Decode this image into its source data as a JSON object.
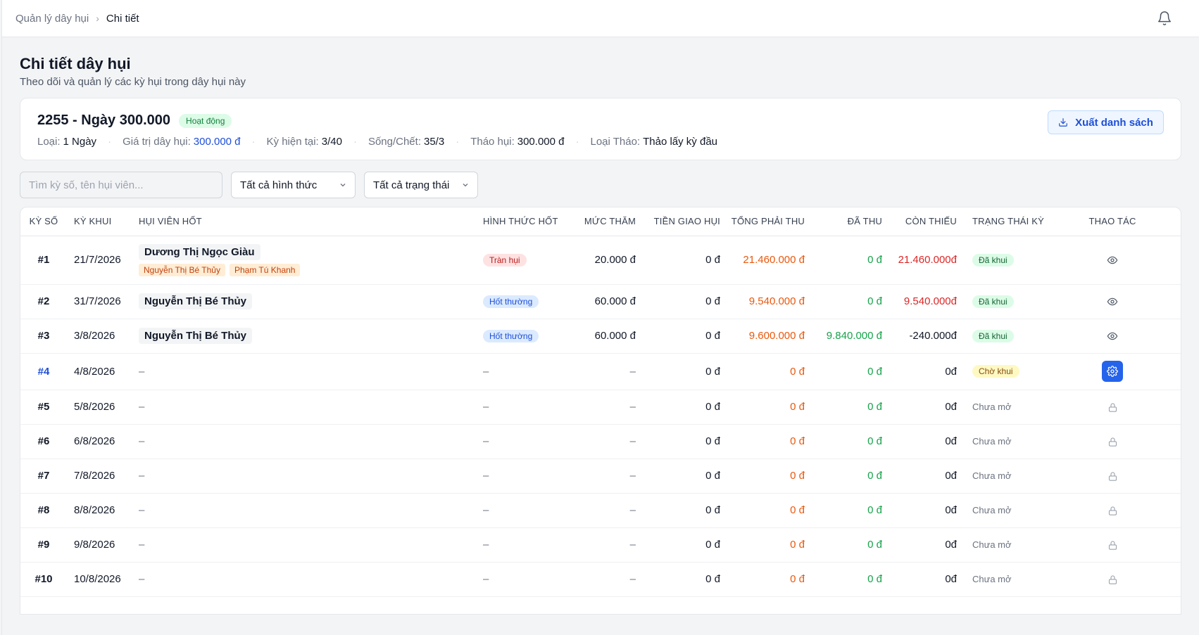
{
  "breadcrumb": {
    "parent": "Quản lý dây hụi",
    "current": "Chi tiết"
  },
  "page": {
    "title": "Chi tiết dây hụi",
    "subtitle": "Theo dõi và quản lý các kỳ hụi trong dây hụi này"
  },
  "summary": {
    "title": "2255 - Ngày 300.000",
    "status": "Hoạt động",
    "type_label": "Loại:",
    "type_value": "1 Ngày",
    "value_label": "Giá trị dây hụi:",
    "value_value": "300.000 đ",
    "period_label": "Kỳ hiện tại:",
    "period_value": "3/40",
    "alive_label": "Sống/Chết:",
    "alive_value": "35/3",
    "thao_label": "Tháo hụi:",
    "thao_value": "300.000 đ",
    "thao_type_label": "Loại Tháo:",
    "thao_type_value": "Thảo lấy kỳ đầu",
    "export_label": "Xuất danh sách"
  },
  "filters": {
    "search_placeholder": "Tìm kỳ số, tên hụi viên...",
    "form_select": "Tất cả hình thức",
    "status_select": "Tất cả trạng thái"
  },
  "table": {
    "headers": [
      "KỲ SỐ",
      "KỲ KHUI",
      "HỤI VIÊN HỐT",
      "HÌNH THỨC HỐT",
      "MỨC THĂM",
      "TIỀN GIAO HỤI",
      "TỔNG PHẢI THU",
      "ĐÃ THU",
      "CÒN THIẾU",
      "TRẠNG THÁI KỲ",
      "THAO TÁC"
    ],
    "rows": [
      {
        "no": "#1",
        "date": "21/7/2026",
        "member": "Dương Thị Ngọc Giàu",
        "subs": [
          "Nguyễn Thị Bé Thủy",
          "Phạm Tú Khanh"
        ],
        "form": "Tràn hụi",
        "bid": "20.000 đ",
        "deliver": "0 đ",
        "total": "21.460.000 đ",
        "paid": "0 đ",
        "owed": "21.460.000đ",
        "status": "Đã khui",
        "action": "eye"
      },
      {
        "no": "#2",
        "date": "31/7/2026",
        "member": "Nguyễn Thị Bé Thủy",
        "subs": [],
        "form": "Hốt thường",
        "bid": "60.000 đ",
        "deliver": "0 đ",
        "total": "9.540.000 đ",
        "paid": "0 đ",
        "owed": "9.540.000đ",
        "status": "Đã khui",
        "action": "eye"
      },
      {
        "no": "#3",
        "date": "3/8/2026",
        "member": "Nguyễn Thị Bé Thủy",
        "subs": [],
        "form": "Hốt thường",
        "bid": "60.000 đ",
        "deliver": "0 đ",
        "total": "9.600.000 đ",
        "paid": "9.840.000 đ",
        "owed": "-240.000đ",
        "status": "Đã khui",
        "action": "eye"
      },
      {
        "no": "#4",
        "date": "4/8/2026",
        "member": "–",
        "subs": [],
        "form": "–",
        "bid": "–",
        "deliver": "0 đ",
        "total": "0 đ",
        "paid": "0 đ",
        "owed": "0đ",
        "status": "Chờ khui",
        "action": "gear"
      },
      {
        "no": "#5",
        "date": "5/8/2026",
        "member": "–",
        "subs": [],
        "form": "–",
        "bid": "–",
        "deliver": "0 đ",
        "total": "0 đ",
        "paid": "0 đ",
        "owed": "0đ",
        "status": "Chưa mở",
        "action": "lock"
      },
      {
        "no": "#6",
        "date": "6/8/2026",
        "member": "–",
        "subs": [],
        "form": "–",
        "bid": "–",
        "deliver": "0 đ",
        "total": "0 đ",
        "paid": "0 đ",
        "owed": "0đ",
        "status": "Chưa mở",
        "action": "lock"
      },
      {
        "no": "#7",
        "date": "7/8/2026",
        "member": "–",
        "subs": [],
        "form": "–",
        "bid": "–",
        "deliver": "0 đ",
        "total": "0 đ",
        "paid": "0 đ",
        "owed": "0đ",
        "status": "Chưa mở",
        "action": "lock"
      },
      {
        "no": "#8",
        "date": "8/8/2026",
        "member": "–",
        "subs": [],
        "form": "–",
        "bid": "–",
        "deliver": "0 đ",
        "total": "0 đ",
        "paid": "0 đ",
        "owed": "0đ",
        "status": "Chưa mở",
        "action": "lock"
      },
      {
        "no": "#9",
        "date": "9/8/2026",
        "member": "–",
        "subs": [],
        "form": "–",
        "bid": "–",
        "deliver": "0 đ",
        "total": "0 đ",
        "paid": "0 đ",
        "owed": "0đ",
        "status": "Chưa mở",
        "action": "lock"
      },
      {
        "no": "#10",
        "date": "10/8/2026",
        "member": "–",
        "subs": [],
        "form": "–",
        "bid": "–",
        "deliver": "0 đ",
        "total": "0 đ",
        "paid": "0 đ",
        "owed": "0đ",
        "status": "Chưa mở",
        "action": "lock"
      }
    ]
  }
}
